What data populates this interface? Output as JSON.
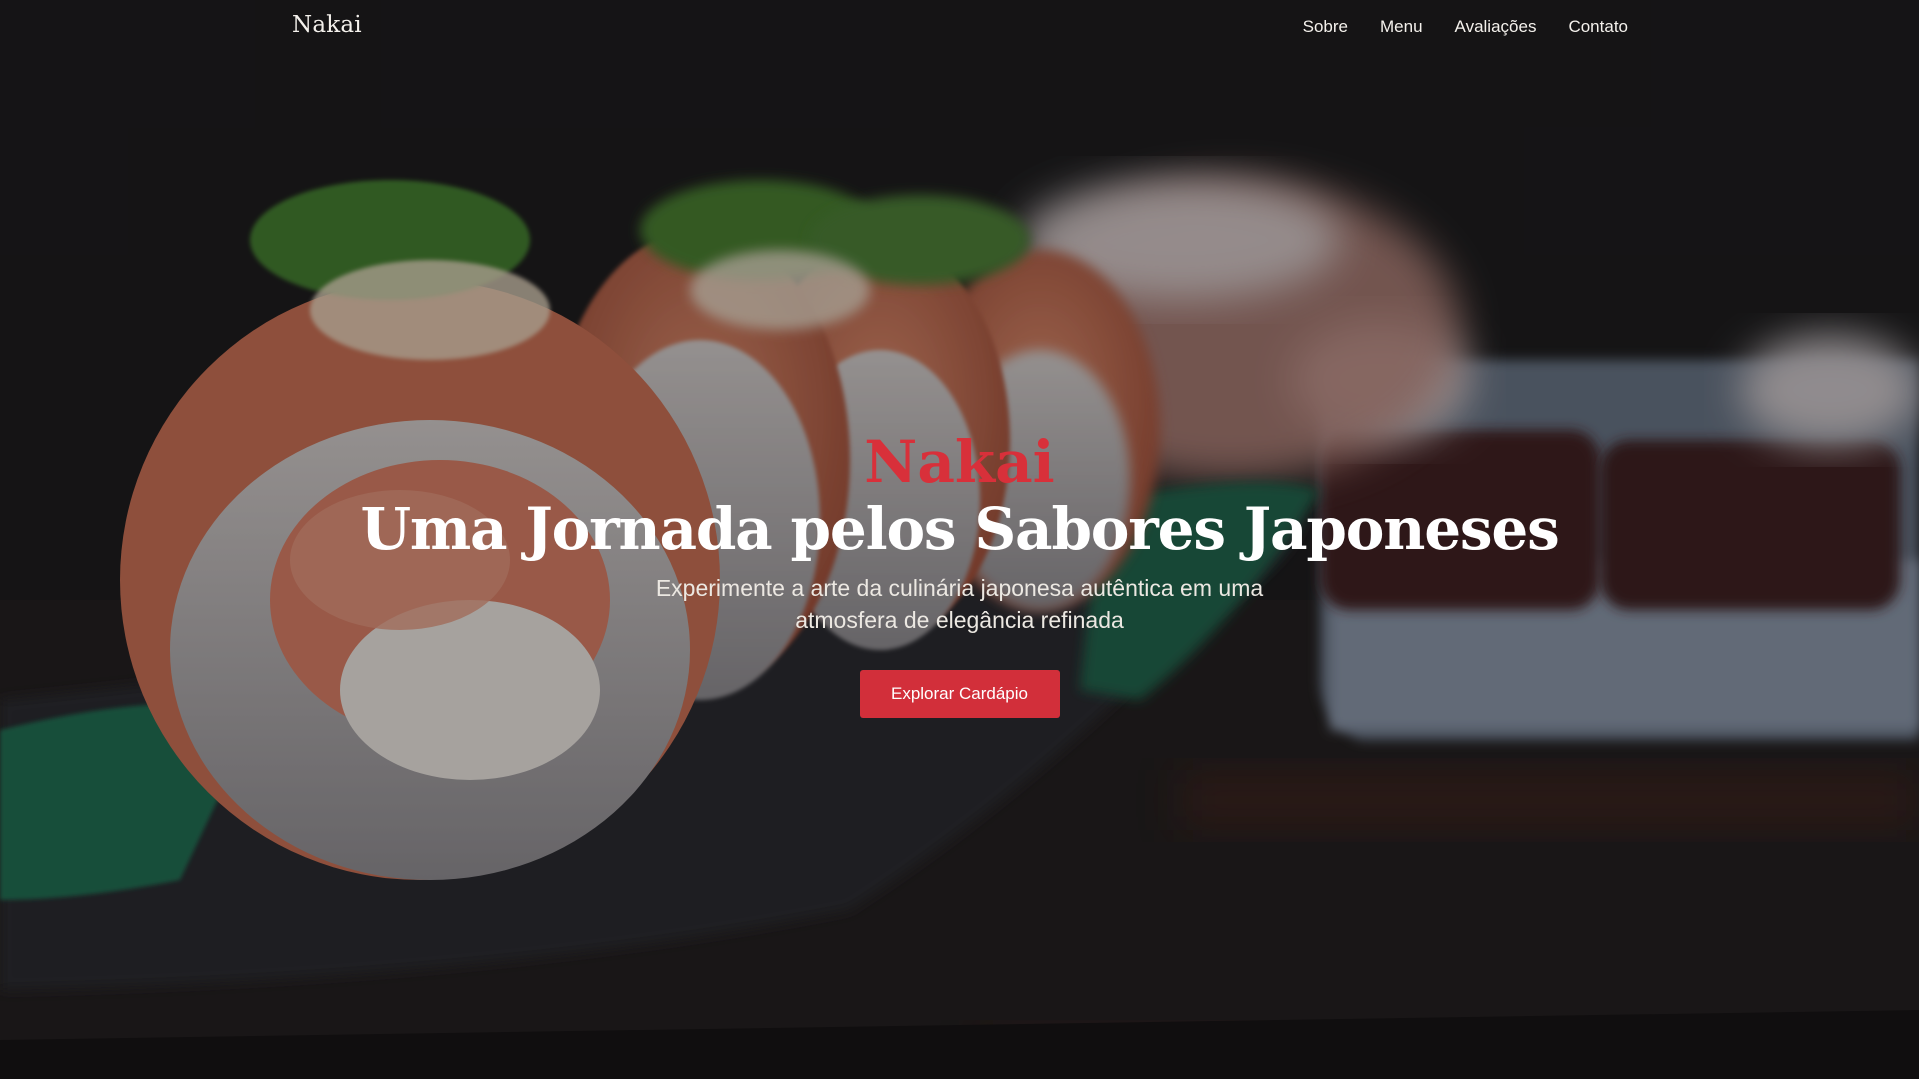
{
  "nav": {
    "brand": "Nakai",
    "links": [
      "Sobre",
      "Menu",
      "Avaliações",
      "Contato"
    ]
  },
  "hero": {
    "kicker": "Nakai",
    "headline": "Uma Jornada pelos Sabores Japoneses",
    "subtitle": "Experimente a arte da culinária japonesa autêntica em uma atmosfera de elegância refinada",
    "cta_label": "Explorar Cardápio"
  },
  "colors": {
    "accent": "#d22f3a",
    "kicker": "#d8303a",
    "text": "#ffffff"
  }
}
